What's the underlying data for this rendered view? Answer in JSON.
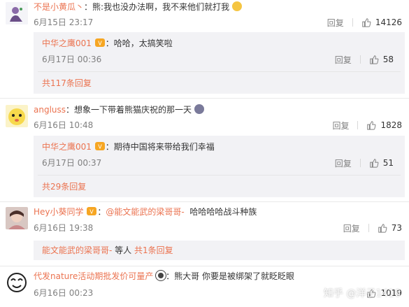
{
  "comments": [
    {
      "username": "不是小黄瓜丶",
      "separator": "：",
      "text": "熊:我也没办法啊，我不来他们就打我",
      "time": "6月15日 23:17",
      "reply_label": "回复",
      "likes": "14126",
      "sub": {
        "username": "中华之鹰001",
        "separator": "：",
        "text": "哈哈，太搞笑啦",
        "time": "6月17日 00:36",
        "reply_label": "回复",
        "likes": "58",
        "more": "共117条回复"
      }
    },
    {
      "username": "angluss",
      "separator": "：",
      "text": "想象一下带着熊猫庆祝的那一天",
      "time": "6月16日 10:48",
      "reply_label": "回复",
      "likes": "1828",
      "sub": {
        "username": "中华之鹰001",
        "separator": "：",
        "text": "期待中国将来带给我们幸福",
        "time": "6月17日 00:37",
        "reply_label": "回复",
        "likes": "51",
        "more": "共29条回复"
      }
    },
    {
      "username": "Hey小葵同学",
      "separator": "：",
      "mention": "@能文能武的梁哥哥-",
      "text": "哈哈哈哈战斗种族",
      "time": "6月16日 19:38",
      "reply_label": "回复",
      "likes": "73",
      "sub": {
        "username": "能文能武的梁哥哥-",
        "text": "等人",
        "more": "共1条回复"
      }
    },
    {
      "username": "代发nature活动期批发价可量产",
      "separator": "：",
      "text": "熊大哥 你要是被绑架了就眨眨眼",
      "time": "6月16日 00:23",
      "likes": "1019"
    }
  ],
  "watermark": "知乎 @洋子1416",
  "colors": {
    "accent": "#eb7350",
    "meta": "#808080",
    "subbg": "#f2f2f5"
  }
}
